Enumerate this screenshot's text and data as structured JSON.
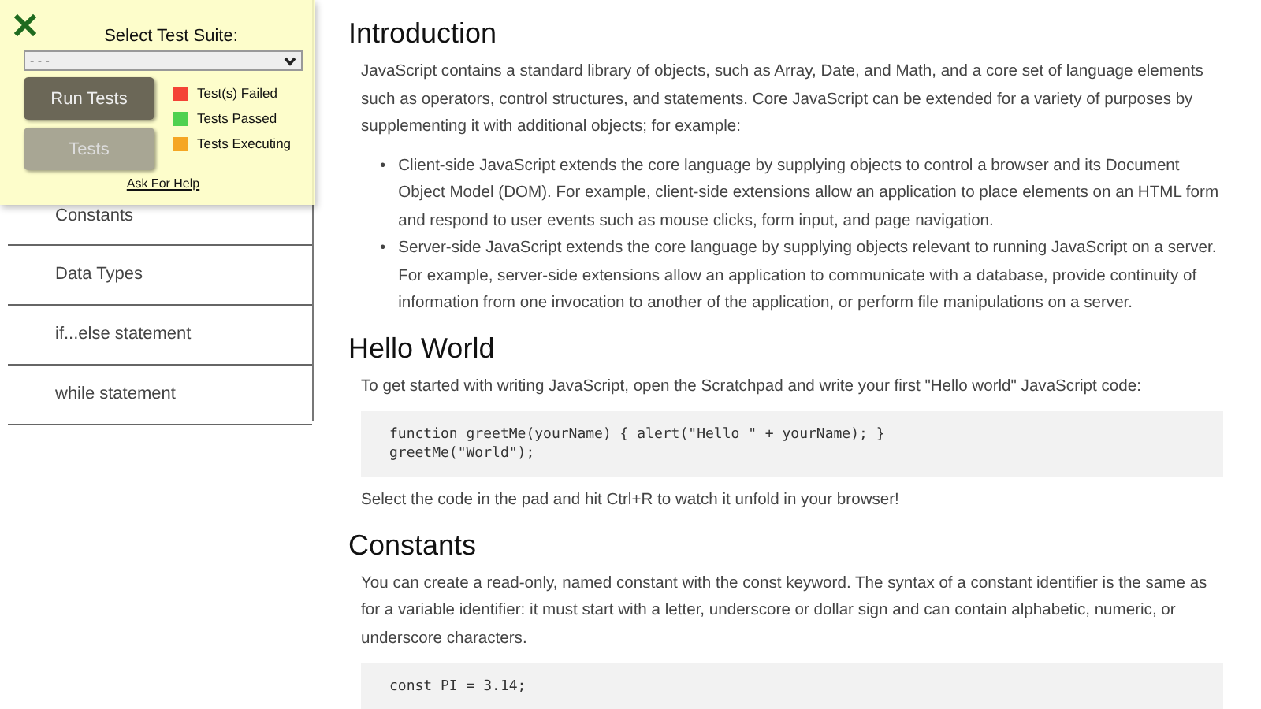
{
  "sidebar": {
    "items": [
      {
        "label": "Constants"
      },
      {
        "label": "Data Types"
      },
      {
        "label": "if...else statement"
      },
      {
        "label": "while statement"
      }
    ]
  },
  "test_panel": {
    "suite_label": "Select Test Suite:",
    "suite_value": "- - -",
    "buttons": [
      {
        "label": "Run Tests",
        "disabled": false
      },
      {
        "label": "Tests",
        "disabled": true
      }
    ],
    "legend": [
      {
        "label": "Test(s) Failed",
        "color": "#f44336"
      },
      {
        "label": "Tests Passed",
        "color": "#4fd14f"
      },
      {
        "label": "Tests Executing",
        "color": "#f5a623"
      }
    ],
    "help_link": "Ask For Help"
  },
  "sections": [
    {
      "heading": "Introduction",
      "blocks": [
        {
          "kind": "text",
          "text": "JavaScript contains a standard library of objects, such as Array, Date, and Math, and a core set of language elements such as operators, control structures, and statements. Core JavaScript can be extended for a variety of purposes by supplementing it with additional objects; for example:"
        },
        {
          "kind": "list",
          "marker": "•",
          "items": [
            "Client-side JavaScript extends the core language by supplying objects to control a browser and its Document Object Model (DOM). For example, client-side extensions allow an application to place elements on an HTML form and respond to user events such as mouse clicks, form input, and page navigation.",
            "Server-side JavaScript extends the core language by supplying objects relevant to running JavaScript on a server. For example, server-side extensions allow an application to communicate with a database, provide continuity of information from one invocation to another of the application, or perform file manipulations on a server."
          ]
        }
      ]
    },
    {
      "heading": "Hello World",
      "blocks": [
        {
          "kind": "text",
          "text": "To get started with writing JavaScript, open the Scratchpad and write your first \"Hello world\" JavaScript code:"
        },
        {
          "kind": "code",
          "lines": [
            "function greetMe(yourName) { alert(\"Hello \" + yourName); }",
            "greetMe(\"World\");"
          ]
        },
        {
          "kind": "text",
          "text": "Select the code in the pad and hit Ctrl+R to watch it unfold in your browser!"
        }
      ]
    },
    {
      "heading": "Constants",
      "blocks": [
        {
          "kind": "text",
          "text": "You can create a read-only, named constant with the const keyword. The syntax of a constant identifier is the same as for a variable identifier: it must start with a letter, underscore or dollar sign and can contain alphabetic, numeric, or underscore characters."
        },
        {
          "kind": "code",
          "lines": [
            "const PI = 3.14;"
          ]
        }
      ]
    }
  ]
}
